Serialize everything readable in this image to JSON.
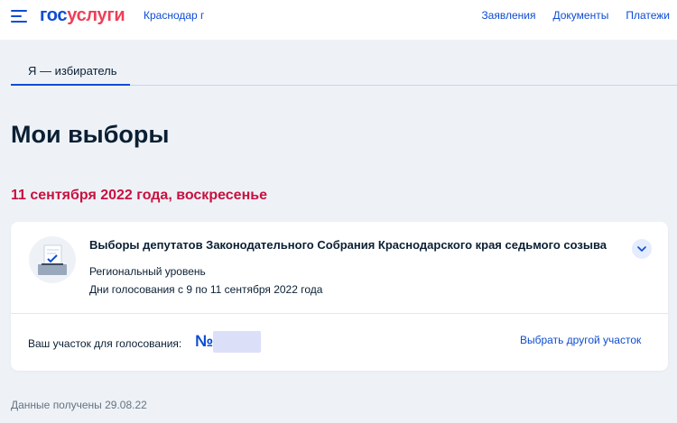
{
  "header": {
    "logo_part1": "гос",
    "logo_part2": "услуги",
    "region": "Краснодар г",
    "nav": [
      "Заявления",
      "Документы",
      "Платежи"
    ]
  },
  "tabs": [
    {
      "label": "Я — избиратель",
      "active": true
    }
  ],
  "page_title": "Мои выборы",
  "election": {
    "date": "11 сентября 2022 года, воскресенье",
    "title": "Выборы депутатов Законодательного Собрания Краснодарского края седьмого созыва",
    "level": "Региональный уровень",
    "voting_days": "Дни голосования с 9 по 11 сентября 2022 года",
    "station_label": "Ваш участок для голосования:",
    "station_number_prefix": "№",
    "change_station_label": "Выбрать другой участок"
  },
  "footer": {
    "data_received": "Данные получены 29.08.22"
  },
  "colors": {
    "accent": "#0d4cd3",
    "logo_red": "#ee3f58",
    "date_red": "#c9103f",
    "background": "#eef2f7"
  },
  "icons": [
    "menu-icon",
    "ballot-illustration",
    "chevron-down-icon"
  ]
}
